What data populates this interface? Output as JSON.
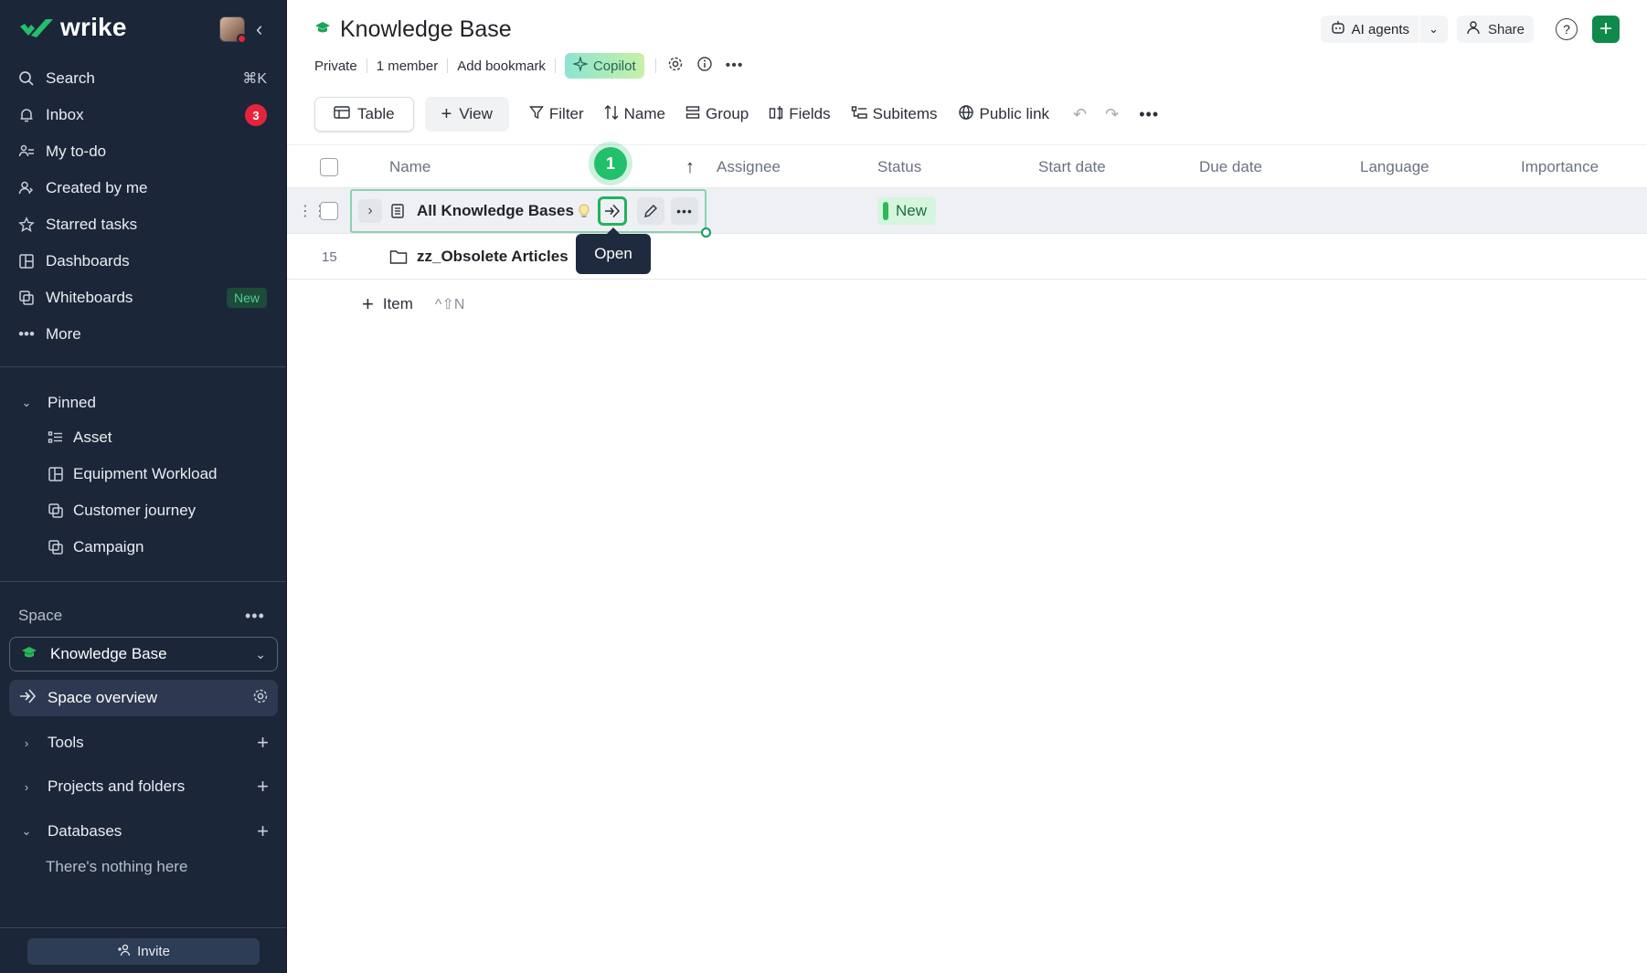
{
  "sidebar": {
    "logo": "wrike",
    "nav": [
      {
        "label": "Search",
        "icon": "search-icon",
        "shortcut": "⌘K"
      },
      {
        "label": "Inbox",
        "icon": "bell-icon",
        "badge": "3"
      },
      {
        "label": "My to-do",
        "icon": "todo-icon"
      },
      {
        "label": "Created by me",
        "icon": "user-created-icon"
      },
      {
        "label": "Starred tasks",
        "icon": "star-icon"
      },
      {
        "label": "Dashboards",
        "icon": "dashboard-icon"
      },
      {
        "label": "Whiteboards",
        "icon": "whiteboard-icon",
        "tag": "New"
      },
      {
        "label": "More",
        "icon": "more-icon"
      }
    ],
    "pinned": {
      "title": "Pinned",
      "items": [
        {
          "label": "Asset",
          "icon": "database-icon"
        },
        {
          "label": "Equipment Workload",
          "icon": "dashboard-icon"
        },
        {
          "label": "Customer journey",
          "icon": "whiteboard-icon"
        },
        {
          "label": "Campaign",
          "icon": "whiteboard-icon"
        }
      ]
    },
    "space": {
      "label": "Space",
      "selected": "Knowledge Base",
      "overview": "Space overview"
    },
    "tree": [
      {
        "label": "Tools",
        "expanded": false
      },
      {
        "label": "Projects and folders",
        "expanded": false
      },
      {
        "label": "Databases",
        "expanded": true
      }
    ],
    "empty_note": "There's nothing here",
    "invite": "Invite"
  },
  "header": {
    "title": "Knowledge Base",
    "ai_agents": "AI agents",
    "share": "Share",
    "help": "?",
    "meta": [
      "Private",
      "1 member",
      "Add bookmark"
    ],
    "copilot": "Copilot"
  },
  "toolbar": {
    "table": "Table",
    "view": "View",
    "filter": "Filter",
    "name": "Name",
    "group": "Group",
    "fields": "Fields",
    "subitems": "Subitems",
    "public_link": "Public link"
  },
  "table": {
    "columns": [
      "Name",
      "Assignee",
      "Status",
      "Start date",
      "Due date",
      "Language",
      "Importance"
    ],
    "rows": [
      {
        "name": "All Knowledge Bases",
        "status": "New",
        "count": ""
      },
      {
        "name": "zz_Obsolete Articles",
        "status": "",
        "count": "15"
      }
    ],
    "add_item": "Item",
    "add_item_shortcut": "^⇧N"
  },
  "overlay": {
    "step": "1",
    "tooltip": "Open"
  },
  "colors": {
    "sidebar_bg": "#1b2638",
    "accent_green": "#0f8a4a",
    "badge_red": "#e5243b",
    "status_new": "#2bb856"
  }
}
